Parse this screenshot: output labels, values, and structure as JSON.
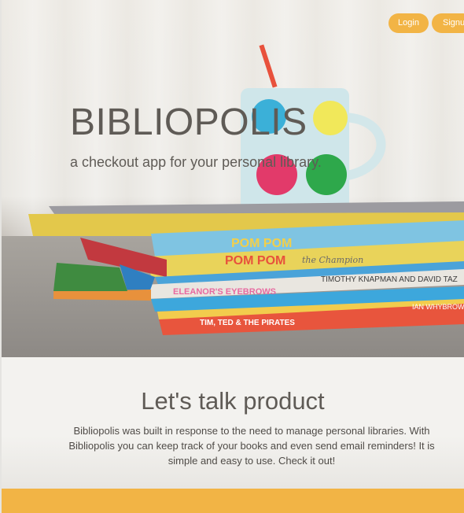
{
  "nav": {
    "login_label": "Login",
    "signup_label": "Signup"
  },
  "hero": {
    "title": "BIBLIOPOLIS",
    "subtitle": "a checkout app for your personal library.",
    "book_spines": [
      "POM POM",
      "POM POM the Champion",
      "ELEANOR'S EYEBROWS",
      "TIMOTHY KNAPMAN AND DAVID TAZ",
      "TIM, TED & THE PIRATES",
      "IAN WHYBROW"
    ]
  },
  "product": {
    "title": "Let's talk product",
    "description": "Bibliopolis was built in response to the need to manage personal libraries. With Bibliopolis you can keep track of your books and even send email reminders! It is simple and easy to use. Check it out!"
  },
  "colors": {
    "accent": "#f2b445",
    "text": "#5f5b56",
    "background": "#f3f2ef"
  }
}
